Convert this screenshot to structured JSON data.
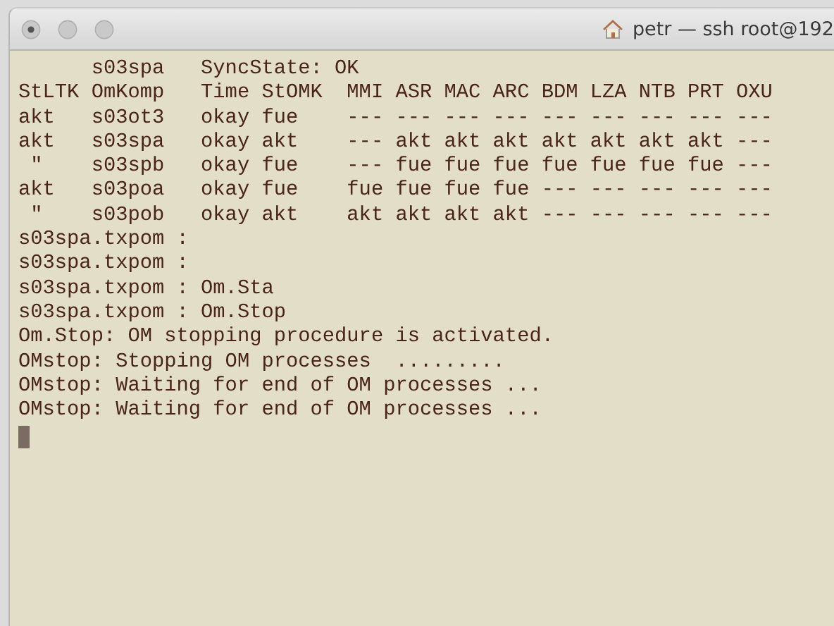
{
  "window": {
    "title": "petr — ssh root@192"
  },
  "terminal": {
    "lines": [
      "      s03spa   SyncState: OK",
      "StLTK OmKomp   Time StOMK  MMI ASR MAC ARC BDM LZA NTB PRT OXU",
      "akt   s03ot3   okay fue    --- --- --- --- --- --- --- --- ---",
      "akt   s03spa   okay akt    --- akt akt akt akt akt akt akt ---",
      " \"    s03spb   okay fue    --- fue fue fue fue fue fue fue ---",
      "akt   s03poa   okay fue    fue fue fue fue --- --- --- --- ---",
      " \"    s03pob   okay akt    akt akt akt akt --- --- --- --- ---",
      "s03spa.txpom :",
      "s03spa.txpom :",
      "s03spa.txpom : Om.Sta",
      "s03spa.txpom : Om.Stop",
      "Om.Stop: OM stopping procedure is activated.",
      "OMstop: Stopping OM processes  .........",
      "OMstop: Waiting for end of OM processes ...",
      "OMstop: Waiting for end of OM processes ..."
    ]
  }
}
